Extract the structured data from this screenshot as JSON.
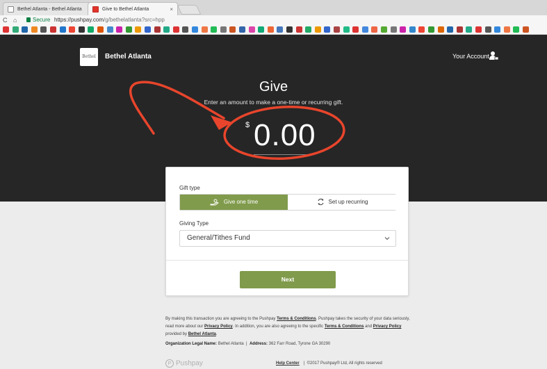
{
  "browser": {
    "tabs": [
      {
        "title": "Bethel Atlanta - Bethel Atlanta",
        "close": "×"
      },
      {
        "title": "Give to Bethel Atlanta",
        "close": "×"
      }
    ],
    "secure_label": "Secure",
    "url_host": "https://pushpay.com",
    "url_path": "/g/bethelatlanta?src=hpp",
    "nav": {
      "back": "C",
      "home": "⌂"
    },
    "bookmark_colors": [
      "#d33",
      "#3a7",
      "#26a",
      "#e82",
      "#555",
      "#c33",
      "#27c",
      "#e43",
      "#333",
      "#1a6",
      "#d50",
      "#48c",
      "#c2a",
      "#393",
      "#e90",
      "#36c",
      "#a33",
      "#2a8",
      "#d33",
      "#555",
      "#38d",
      "#e74",
      "#2b5",
      "#777",
      "#c52",
      "#36a",
      "#d4a",
      "#1a7",
      "#e63",
      "#47b",
      "#333",
      "#c33",
      "#2a6",
      "#e90",
      "#36c",
      "#a44",
      "#2b8",
      "#d33",
      "#48d",
      "#e64",
      "#5a3",
      "#777",
      "#c2a",
      "#38c",
      "#e43",
      "#393",
      "#d60",
      "#26a",
      "#a33",
      "#2a8",
      "#d33",
      "#555",
      "#38d",
      "#e74",
      "#2b5",
      "#c52"
    ]
  },
  "header": {
    "logo_text": "Bethel",
    "org_name": "Bethel Atlanta",
    "account_label": "Your Account",
    "give_title": "Give",
    "give_subtitle": "Enter an amount to make a one-time or recurring gift.",
    "currency_symbol": "$",
    "amount": "0.00"
  },
  "form": {
    "gift_type_label": "Gift type",
    "gift_type_options": [
      {
        "label": "Give one time",
        "selected": true
      },
      {
        "label": "Set up recurring",
        "selected": false
      }
    ],
    "giving_type_label": "Giving Type",
    "giving_type_value": "General/Tithes Fund",
    "next_label": "Next"
  },
  "footer": {
    "legal_p1": "By making this transaction you are agreeing to the Pushpay",
    "terms": "Terms & Conditions",
    "legal_p2": ". Pushpay takes the security of your data seriously, read more about our",
    "privacy": "Privacy Policy",
    "legal_p3": ". In addition, you are also agreeing to the specific",
    "terms2": "Terms & Conditions",
    "legal_and": "and",
    "privacy2": "Privacy Policy",
    "provided_by": "provided by",
    "org_link": "Bethel Atlanta",
    "legal_name_label": "Organization Legal Name:",
    "legal_name_value": "Bethel Atlanta",
    "address_label": "Address:",
    "address_value": "362 Farr Road, Tyrone GA 30290",
    "brand": "Pushpay",
    "brand_mark": "P",
    "help_center": "Help Center",
    "copyright": "©2017 Pushpay® Ltd, All rights reserved"
  },
  "colors": {
    "header_bg": "#262626",
    "accent_green": "#809b4c",
    "annotation_red": "#e8452c"
  }
}
